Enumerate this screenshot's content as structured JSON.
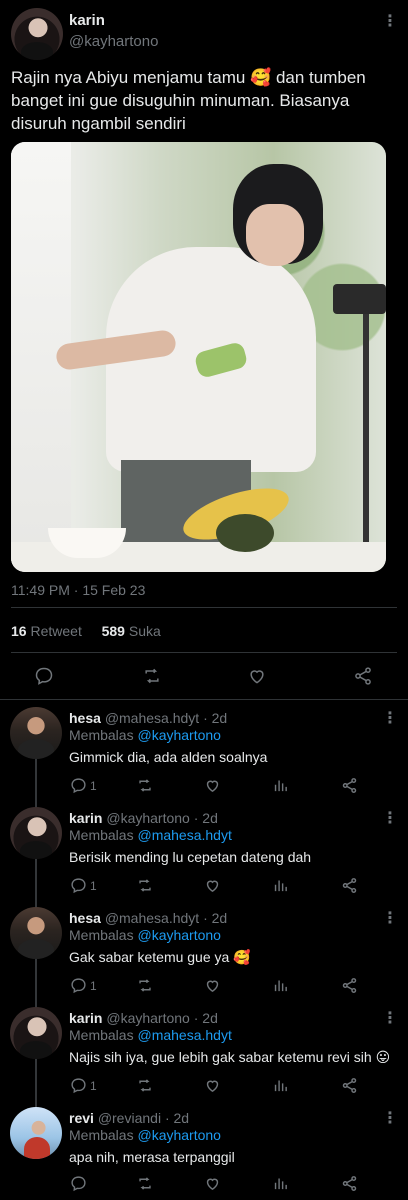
{
  "main_tweet": {
    "author_name": "karin",
    "author_handle": "@kayhartono",
    "text": "Rajin nya Abiyu menjamu tamu 🥰 dan tumben banget ini gue disuguhin minuman. Biasanya disuruh ngambil sendiri",
    "timestamp": "11:49 PM · 15 Feb 23",
    "retweet_count": "16",
    "retweet_label": "Retweet",
    "like_count": "589",
    "like_label": "Suka"
  },
  "replying_label": "Membalas",
  "replies": [
    {
      "name": "hesa",
      "handle": "@mahesa.hdyt",
      "time": "· 2d",
      "replying_to": "@kayhartono",
      "text": "Gimmick dia, ada alden soalnya",
      "reply_count": "1"
    },
    {
      "name": "karin",
      "handle": "@kayhartono",
      "time": "· 2d",
      "replying_to": "@mahesa.hdyt",
      "text": "Berisik mending lu cepetan dateng dah",
      "reply_count": "1"
    },
    {
      "name": "hesa",
      "handle": "@mahesa.hdyt",
      "time": "· 2d",
      "replying_to": "@kayhartono",
      "text": "Gak sabar ketemu gue ya 🥰",
      "reply_count": "1"
    },
    {
      "name": "karin",
      "handle": "@kayhartono",
      "time": "· 2d",
      "replying_to": "@mahesa.hdyt",
      "text": "Najis sih iya, gue lebih gak sabar ketemu revi sih 😛",
      "reply_count": "1"
    },
    {
      "name": "revi",
      "handle": "@reviandi",
      "time": "· 2d",
      "replying_to": "@kayhartono",
      "text": "apa nih, merasa terpanggil",
      "reply_count": ""
    }
  ],
  "colors": {
    "background": "#000000",
    "text": "#e7e9ea",
    "muted": "#71767b",
    "link": "#1d9bf0",
    "divider": "#2f3336"
  }
}
